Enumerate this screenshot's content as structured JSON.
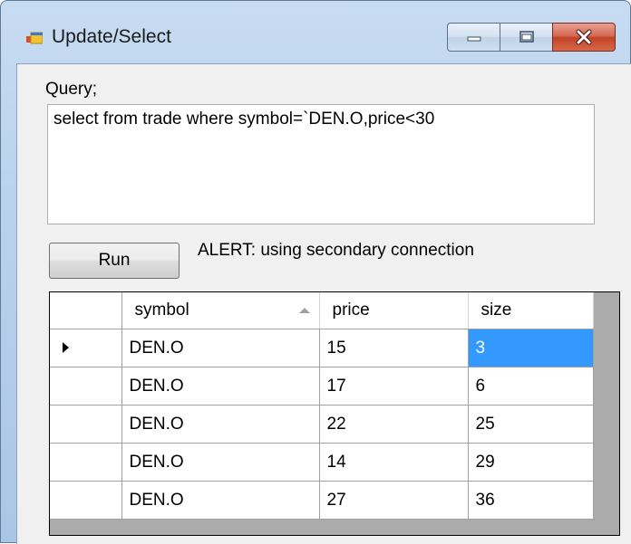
{
  "window": {
    "title": "Update/Select"
  },
  "query": {
    "label": "Query;",
    "text": "select from trade where symbol=`DEN.O,price<30"
  },
  "run_button": {
    "label": "Run"
  },
  "alert": {
    "text": "ALERT: using secondary connection"
  },
  "grid": {
    "columns": [
      "symbol",
      "price",
      "size"
    ],
    "sorted_column": "symbol",
    "rows": [
      {
        "symbol": "DEN.O",
        "price": "15",
        "size": "3",
        "current": true
      },
      {
        "symbol": "DEN.O",
        "price": "17",
        "size": "6"
      },
      {
        "symbol": "DEN.O",
        "price": "22",
        "size": "25"
      },
      {
        "symbol": "DEN.O",
        "price": "14",
        "size": "29"
      },
      {
        "symbol": "DEN.O",
        "price": "27",
        "size": "36"
      }
    ],
    "selected_cell": {
      "row": 0,
      "column": "size"
    },
    "selection_color": "#3399ff"
  }
}
